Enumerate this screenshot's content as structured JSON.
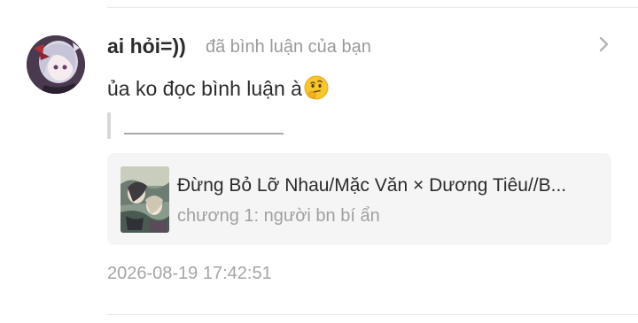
{
  "notification": {
    "username": "ai hỏi=))",
    "action_text": "đã bình luận của bạn",
    "comment_text": "ủa ko đọc bình luận à",
    "comment_emoji": "thinking-face-icon",
    "chevron_icon": "chevron-right-icon",
    "timestamp": "2026-08-19 17:42:51"
  },
  "story_card": {
    "title": "Đừng Bỏ Lỡ Nhau/Mặc Văn × Dương Tiêu//B...",
    "chapter": "chương 1: người bn bí ẩn",
    "cover_icon": "story-cover-image"
  },
  "colors": {
    "username": "#2b2b2b",
    "secondary_text": "#9a9a9a",
    "card_background": "#f5f5f5",
    "divider": "#e8e8e8"
  }
}
